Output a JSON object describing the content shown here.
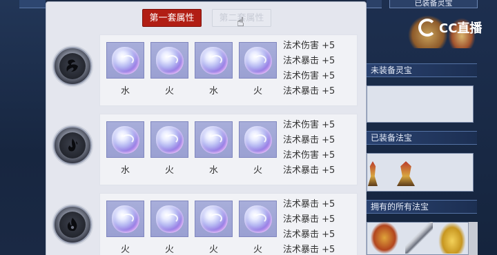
{
  "background": {
    "top_right_tab": "已装备灵宝",
    "right_rows": [
      "未装备灵宝",
      "已装备法宝",
      "拥有的所有法宝"
    ],
    "logo_text": "CC直播"
  },
  "tabs": {
    "first": "第一套属性",
    "second": "第二套属性"
  },
  "groups": [
    {
      "emblem": "water-emblem",
      "slots": [
        {
          "element": "水",
          "gem": "spirit-gem-icon"
        },
        {
          "element": "火",
          "gem": "spirit-gem-icon"
        },
        {
          "element": "水",
          "gem": "spirit-gem-icon"
        },
        {
          "element": "火",
          "gem": "spirit-gem-icon"
        }
      ],
      "attrs": [
        "法术伤害 +5",
        "法术暴击 +5",
        "法术伤害 +5",
        "法术暴击 +5"
      ]
    },
    {
      "emblem": "fire-emblem",
      "slots": [
        {
          "element": "水",
          "gem": "spirit-gem-icon"
        },
        {
          "element": "火",
          "gem": "spirit-gem-icon"
        },
        {
          "element": "水",
          "gem": "spirit-gem-icon"
        },
        {
          "element": "火",
          "gem": "spirit-gem-icon"
        }
      ],
      "attrs": [
        "法术伤害 +5",
        "法术暴击 +5",
        "法术伤害 +5",
        "法术暴击 +5"
      ]
    },
    {
      "emblem": "flame-emblem",
      "slots": [
        {
          "element": "火",
          "gem": "spirit-gem-icon"
        },
        {
          "element": "火",
          "gem": "spirit-gem-icon"
        },
        {
          "element": "火",
          "gem": "spirit-gem-icon"
        },
        {
          "element": "火",
          "gem": "spirit-gem-icon"
        }
      ],
      "attrs": [
        "法术暴击 +5",
        "法术暴击 +5",
        "法术暴击 +5",
        "法术暴击 +5"
      ]
    }
  ]
}
